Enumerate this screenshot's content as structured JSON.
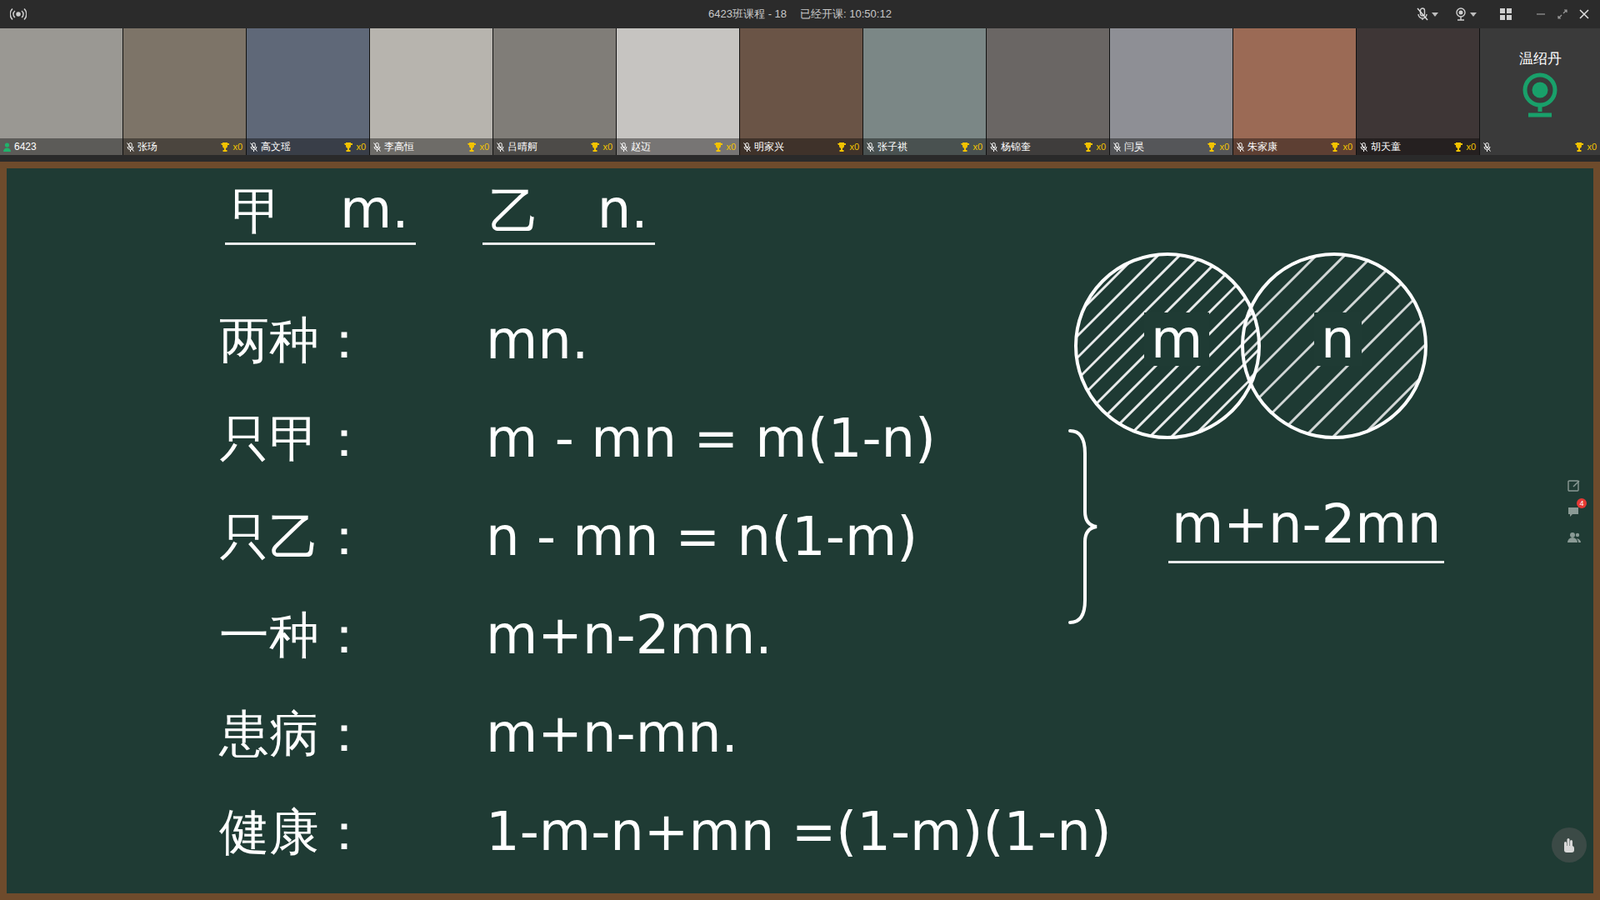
{
  "window": {
    "title": "6423班课程 - 18",
    "elapsed": "已经开课: 10:50:12"
  },
  "controls": {
    "mic_muted": true
  },
  "participants": [
    {
      "name": "6423",
      "kind": "classroom",
      "muted": false
    },
    {
      "name": "张玚",
      "kind": "student",
      "muted": true,
      "awards": "x0"
    },
    {
      "name": "高文瑶",
      "kind": "student",
      "muted": true,
      "awards": "x0"
    },
    {
      "name": "李高恒",
      "kind": "student",
      "muted": true,
      "awards": "x0"
    },
    {
      "name": "吕晴舸",
      "kind": "student",
      "muted": true,
      "awards": "x0"
    },
    {
      "name": "赵迈",
      "kind": "student",
      "muted": true,
      "awards": "x0"
    },
    {
      "name": "明家兴",
      "kind": "student",
      "muted": true,
      "awards": "x0"
    },
    {
      "name": "张子祺",
      "kind": "student",
      "muted": true,
      "awards": "x0"
    },
    {
      "name": "杨锦奎",
      "kind": "student",
      "muted": true,
      "awards": "x0"
    },
    {
      "name": "闫昊",
      "kind": "student",
      "muted": true,
      "awards": "x0"
    },
    {
      "name": "朱家康",
      "kind": "student",
      "muted": true,
      "awards": "x0"
    },
    {
      "name": "胡天童",
      "kind": "student",
      "muted": true,
      "awards": "x0"
    }
  ],
  "teacher": {
    "name": "温绍丹",
    "muted": true,
    "awards": "x0"
  },
  "board": {
    "header": [
      {
        "label": "甲",
        "value": "m."
      },
      {
        "label": "乙",
        "value": "n."
      }
    ],
    "rows": [
      {
        "label": "两种：",
        "expr": "mn."
      },
      {
        "label": "只甲：",
        "expr": "m - mn = m(1-n)"
      },
      {
        "label": "只乙：",
        "expr": "n - mn = n(1-m)"
      },
      {
        "label": "一种：",
        "expr": "m+n-2mn."
      },
      {
        "label": "患病：",
        "expr": "m+n-mn."
      },
      {
        "label": "健康：",
        "expr": "1-m-n+mn =(1-m)(1-n)"
      }
    ],
    "venn": {
      "left": "m",
      "right": "n"
    },
    "result": "m+n-2mn"
  },
  "tools": {
    "chat_badge": "4"
  }
}
